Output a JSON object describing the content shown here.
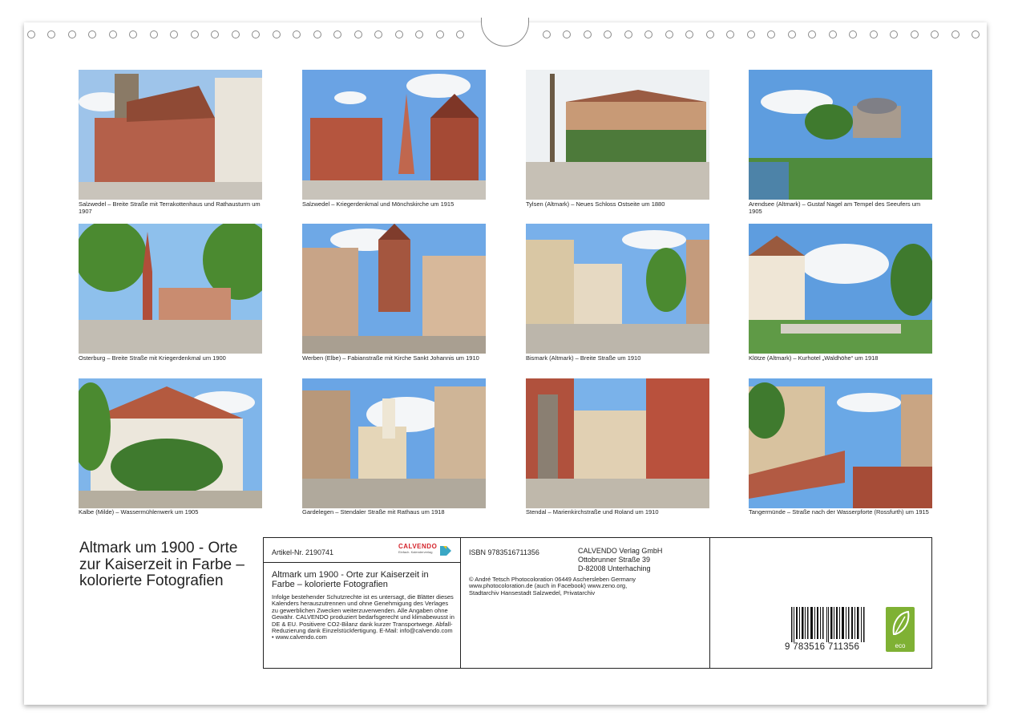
{
  "photos": [
    {
      "caption": "Salzwedel – Breite Straße mit Terrakottenhaus und Rathausturm um 1907"
    },
    {
      "caption": "Salzwedel – Kriegerdenkmal und Mönchskirche um 1915"
    },
    {
      "caption": "Tylsen (Altmark) – Neues Schloss Ostseite um 1880"
    },
    {
      "caption": "Arendsee (Altmark) – Gustaf Nagel am Tempel des Seeufers um 1905"
    },
    {
      "caption": "Osterburg – Breite Straße mit Kriegerdenkmal um 1900"
    },
    {
      "caption": "Werben (Elbe) – Fabianstraße mit Kirche Sankt Johannis um 1910"
    },
    {
      "caption": "Bismark (Altmark) – Breite Straße um 1910"
    },
    {
      "caption": "Klötze (Altmark) – Kurhotel „Waldhöhe“ um 1918"
    },
    {
      "caption": "Kalbe (Milde) – Wassermühlenwerk um 1905"
    },
    {
      "caption": "Gardelegen – Stendaler Straße mit Rathaus um 1918"
    },
    {
      "caption": "Stendal – Marienkirchstraße und Roland um 1910"
    },
    {
      "caption": "Tangermünde – Straße nach der Wasserpforte (Rossfurth) um 1915"
    }
  ],
  "calendar_title": "Altmark um 1900 - Orte zur Kaiserzeit in Farbe – kolorierte Fotografien",
  "info": {
    "article_no": "Artikel-Nr. 2190741",
    "logo_word": "CALVENDO",
    "logo_sub": "Einfach. Kalenderverlag",
    "product_title": "Altmark um 1900 - Orte zur Kaiserzeit in Farbe – kolorierte Fotografien",
    "legal_text": "Infolge bestehender Schutzrechte ist es untersagt, die Blätter dieses Kalenders herauszutrennen und ohne Genehmigung des Verlages zu gewerblichen Zwecken weiterzuverwenden. Alle Angaben ohne Gewähr. CALVENDO produziert bedarfsgerecht und klimabewusst in DE & EU. Positivere CO2-Bilanz dank kurzer Transportwege. Abfall-Reduzierung dank Einzelstückfertigung. E-Mail: info@calvendo.com • www.calvendo.com",
    "isbn": "ISBN 9783516711356",
    "publisher_line1": "CALVENDO Verlag GmbH",
    "publisher_line2": "Ottobrunner Straße 39",
    "publisher_line3": "D-82008 Unterhaching",
    "credits": "© André Tetsch Photocoloration 06449 Aschersleben Germany www.photocoloration.de (auch in Facebook) www.zeno.org, Stadtarchiv Hansestadt Salzwedel, Privatarchiv",
    "barcode_digits": "9 783516 711356",
    "eco_label": "eco"
  }
}
